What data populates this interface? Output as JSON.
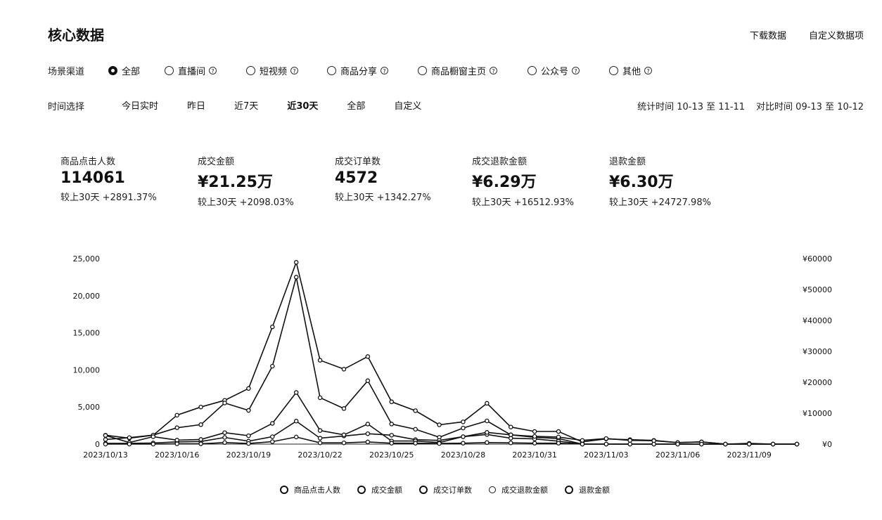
{
  "header": {
    "title": "核心数据",
    "download_label": "下载数据",
    "custom_label": "自定义数据项"
  },
  "channel": {
    "label": "场景渠道",
    "options": [
      {
        "label": "全部",
        "selected": true,
        "help": false
      },
      {
        "label": "直播间",
        "selected": false,
        "help": true
      },
      {
        "label": "短视频",
        "selected": false,
        "help": true
      },
      {
        "label": "商品分享",
        "selected": false,
        "help": true
      },
      {
        "label": "商品橱窗主页",
        "selected": false,
        "help": true
      },
      {
        "label": "公众号",
        "selected": false,
        "help": true
      },
      {
        "label": "其他",
        "selected": false,
        "help": true
      }
    ]
  },
  "time": {
    "label": "时间选择",
    "options": [
      {
        "label": "今日实时",
        "active": false
      },
      {
        "label": "昨日",
        "active": false
      },
      {
        "label": "近7天",
        "active": false
      },
      {
        "label": "近30天",
        "active": true
      },
      {
        "label": "全部",
        "active": false
      },
      {
        "label": "自定义",
        "active": false
      }
    ],
    "stat_period": "统计时间 10-13 至 11-11",
    "compare_period": "对比时间 09-13 至 10-12"
  },
  "kpis": [
    {
      "label": "商品点击人数",
      "value": "114061",
      "compare": "较上30天 +2891.37%"
    },
    {
      "label": "成交金额",
      "value": "¥21.25万",
      "compare": "较上30天 +2098.03%"
    },
    {
      "label": "成交订单数",
      "value": "4572",
      "compare": "较上30天 +1342.27%"
    },
    {
      "label": "成交退款金额",
      "value": "¥6.29万",
      "compare": "较上30天 +16512.93%"
    },
    {
      "label": "退款金额",
      "value": "¥6.30万",
      "compare": "较上30天 +24727.98%"
    }
  ],
  "chart_data": {
    "type": "line",
    "x": [
      "2023/10/13",
      "2023/10/14",
      "2023/10/15",
      "2023/10/16",
      "2023/10/17",
      "2023/10/18",
      "2023/10/19",
      "2023/10/20",
      "2023/10/21",
      "2023/10/22",
      "2023/10/23",
      "2023/10/24",
      "2023/10/25",
      "2023/10/26",
      "2023/10/27",
      "2023/10/28",
      "2023/10/29",
      "2023/10/30",
      "2023/10/31",
      "2023/11/01",
      "2023/11/02",
      "2023/11/03",
      "2023/11/04",
      "2023/11/05",
      "2023/11/06",
      "2023/11/07",
      "2023/11/08",
      "2023/11/09",
      "2023/11/10",
      "2023/11/11"
    ],
    "x_tick_labels": [
      "2023/10/13",
      "2023/10/16",
      "2023/10/19",
      "2023/10/22",
      "2023/10/25",
      "2023/10/28",
      "2023/10/31",
      "2023/11/03",
      "2023/11/06",
      "2023/11/09"
    ],
    "y_left": {
      "min": 0,
      "max": 25000,
      "ticks": [
        "0",
        "5,000",
        "10,000",
        "15,000",
        "20,000",
        "25,000"
      ]
    },
    "y_right": {
      "min": 0,
      "max": 60000,
      "ticks": [
        "¥0",
        "¥10000",
        "¥20000",
        "¥30000",
        "¥40000",
        "¥50000",
        "¥60000"
      ]
    },
    "legend_position": "bottom",
    "series": [
      {
        "name": "商品点击人数",
        "axis": "left",
        "values": [
          1200,
          800,
          1200,
          3900,
          5000,
          5900,
          7500,
          15800,
          24500,
          11300,
          10100,
          11800,
          5700,
          4500,
          2600,
          3000,
          5500,
          2300,
          1700,
          1700,
          300,
          700,
          600,
          500,
          200,
          300,
          0,
          100,
          0,
          0
        ]
      },
      {
        "name": "成交金额",
        "axis": "right",
        "values": [
          1500,
          2100,
          2900,
          5300,
          6300,
          13300,
          10900,
          25200,
          54000,
          15000,
          11500,
          20500,
          6500,
          4800,
          2200,
          5200,
          7500,
          3000,
          2200,
          1800,
          0,
          0,
          0,
          0,
          0,
          0,
          0,
          0,
          0,
          0
        ]
      },
      {
        "name": "成交订单数",
        "axis": "left",
        "values": [
          100,
          100,
          150,
          300,
          350,
          900,
          400,
          1000,
          3100,
          800,
          1100,
          1400,
          1200,
          600,
          500,
          1000,
          1300,
          800,
          700,
          400,
          0,
          0,
          0,
          0,
          0,
          0,
          0,
          0,
          0,
          0
        ]
      },
      {
        "name": "成交退款金额",
        "axis": "right",
        "values": [
          2800,
          500,
          2400,
          1300,
          1500,
          3700,
          2700,
          6700,
          16700,
          4400,
          3000,
          6500,
          1000,
          1000,
          500,
          2400,
          3800,
          3000,
          2500,
          2300,
          1200,
          1800,
          1200,
          1100,
          500,
          700,
          0,
          0,
          0,
          0
        ]
      },
      {
        "name": "退款金额",
        "axis": "right",
        "values": [
          0,
          0,
          0,
          100,
          100,
          500,
          200,
          800,
          2300,
          400,
          400,
          700,
          300,
          300,
          200,
          300,
          500,
          400,
          300,
          300,
          0,
          0,
          0,
          0,
          0,
          0,
          0,
          0,
          0,
          0
        ]
      }
    ]
  }
}
